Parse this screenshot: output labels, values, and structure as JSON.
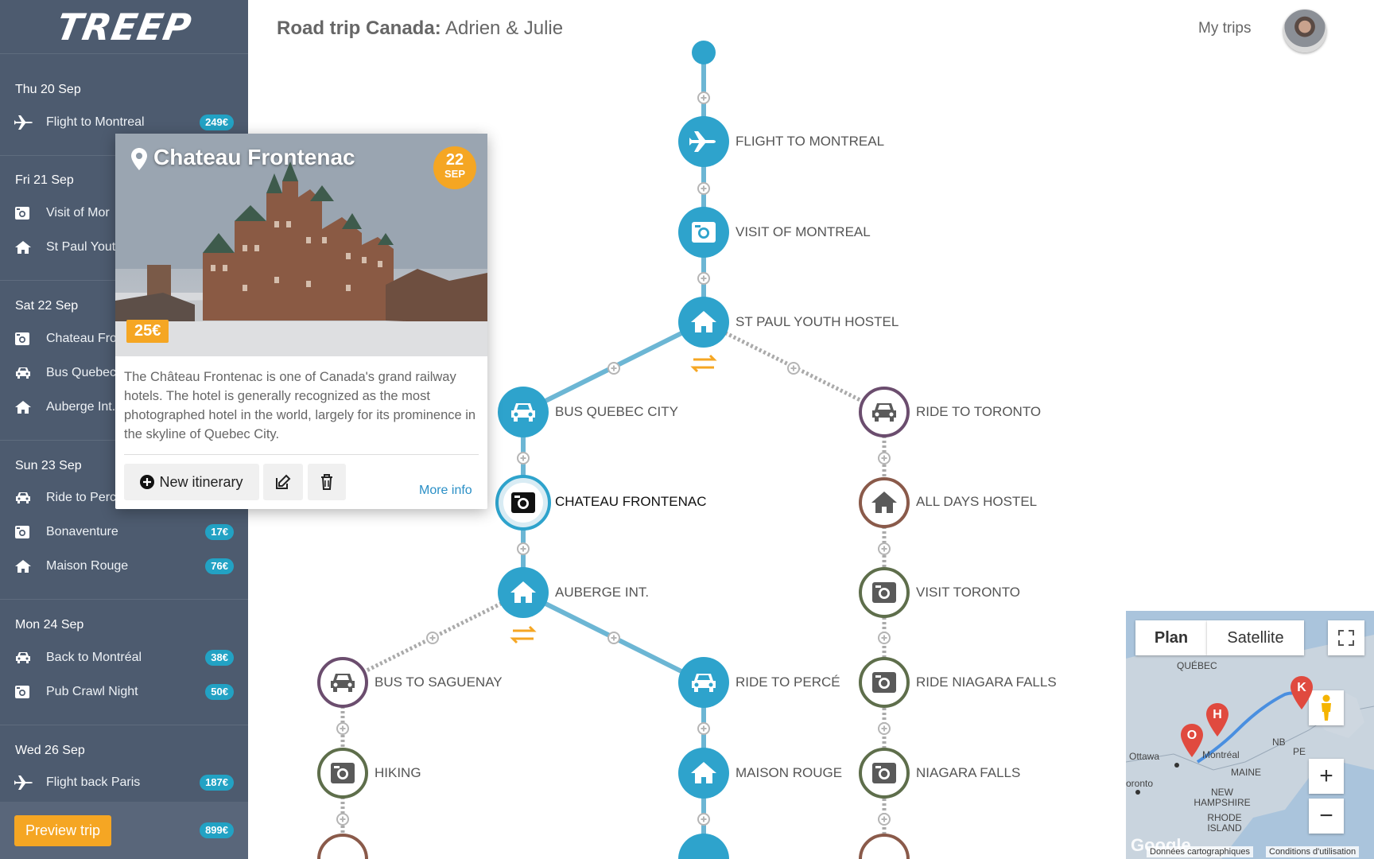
{
  "app": {
    "logo": "TREEP"
  },
  "header": {
    "title_bold": "Road trip Canada:",
    "title_rest": " Adrien & Julie",
    "my_trips": "My trips"
  },
  "sidebar": {
    "days": [
      {
        "label": "Thu 20 Sep",
        "items": [
          {
            "icon": "plane-icon",
            "label": "Flight to Montreal",
            "price": "249€"
          }
        ]
      },
      {
        "label": "Fri 21 Sep",
        "items": [
          {
            "icon": "camera-icon",
            "label": "Visit of Mor"
          },
          {
            "icon": "home-icon",
            "label": "St Paul Yout"
          }
        ]
      },
      {
        "label": "Sat 22 Sep",
        "items": [
          {
            "icon": "camera-icon",
            "label": "Chateau Fro"
          },
          {
            "icon": "car-icon",
            "label": "Bus Quebec"
          },
          {
            "icon": "home-icon",
            "label": "Auberge Int."
          }
        ]
      },
      {
        "label": "Sun 23 Sep",
        "items": [
          {
            "icon": "car-icon",
            "label": "Ride to Perc"
          },
          {
            "icon": "camera-icon",
            "label": "Bonaventure",
            "price": "17€"
          },
          {
            "icon": "home-icon",
            "label": "Maison Rouge",
            "price": "76€"
          }
        ]
      },
      {
        "label": "Mon 24 Sep",
        "items": [
          {
            "icon": "car-icon",
            "label": "Back to Montréal",
            "price": "38€"
          },
          {
            "icon": "camera-icon",
            "label": "Pub Crawl Night",
            "price": "50€"
          }
        ]
      },
      {
        "label": "Wed 26 Sep",
        "items": [
          {
            "icon": "plane-icon",
            "label": "Flight back Paris",
            "price": "187€"
          }
        ]
      }
    ],
    "preview_label": "Preview trip",
    "total": "899€"
  },
  "tree": {
    "nodes": [
      {
        "id": "flight",
        "label": "FLIGHT TO MONTREAL",
        "icon": "plane-icon",
        "style": "filled"
      },
      {
        "id": "visit-mtl",
        "label": "VISIT OF MONTREAL",
        "icon": "camera-icon",
        "style": "filled"
      },
      {
        "id": "st-paul",
        "label": "ST PAUL YOUTH HOSTEL",
        "icon": "home-icon",
        "style": "filled"
      },
      {
        "id": "bus-qc",
        "label": "BUS QUEBEC CITY",
        "icon": "car-icon",
        "style": "filled"
      },
      {
        "id": "chateau",
        "label": "CHATEAU FRONTENAC",
        "icon": "camera-icon",
        "style": "selected"
      },
      {
        "id": "auberge",
        "label": "AUBERGE INT.",
        "icon": "home-icon",
        "style": "filled"
      },
      {
        "id": "ride-perce",
        "label": "RIDE TO PERCÉ",
        "icon": "car-icon",
        "style": "filled"
      },
      {
        "id": "maison",
        "label": "MAISON ROUGE",
        "icon": "home-icon",
        "style": "filled"
      },
      {
        "id": "bus-sag",
        "label": "BUS TO SAGUENAY",
        "icon": "car-icon",
        "style": "outline-purple"
      },
      {
        "id": "hiking",
        "label": "HIKING",
        "icon": "camera-icon",
        "style": "outline-green"
      },
      {
        "id": "ride-tor",
        "label": "RIDE TO TORONTO",
        "icon": "car-icon",
        "style": "outline-purple"
      },
      {
        "id": "all-days",
        "label": "ALL DAYS HOSTEL",
        "icon": "home-icon",
        "style": "outline-brown"
      },
      {
        "id": "visit-tor",
        "label": "VISIT TORONTO",
        "icon": "camera-icon",
        "style": "outline-green"
      },
      {
        "id": "ride-niag",
        "label": "RIDE NIAGARA FALLS",
        "icon": "camera-icon",
        "style": "outline-green"
      },
      {
        "id": "niagara",
        "label": "NIAGARA FALLS",
        "icon": "camera-icon",
        "style": "outline-green"
      }
    ]
  },
  "popup": {
    "title": "Chateau Frontenac",
    "day": "22",
    "month": "SEP",
    "price": "25€",
    "description": "The Château Frontenac is one of Canada's grand railway hotels. The hotel is generally recognized as the most photographed hotel in the world, largely for its prominence in the skyline of Quebec City.",
    "new_itinerary": "New itinerary",
    "more_info": "More info"
  },
  "map": {
    "tab_plan": "Plan",
    "tab_satellite": "Satellite",
    "labels": [
      "QUÉBEC",
      "Ottawa",
      "Montréal",
      "MAINE",
      "NEW HAMPSHIRE",
      "RHODE ISLAND",
      "NB",
      "PE",
      "oronto"
    ],
    "markers": [
      "O",
      "H",
      "K"
    ],
    "attribution": "Données cartographiques",
    "terms": "Conditions d'utilisation",
    "google": "Google"
  },
  "colors": {
    "sidebar": "#4d5b6f",
    "primary": "#2ea3cc",
    "accent": "#f5a623",
    "badge": "#22a2c4"
  }
}
